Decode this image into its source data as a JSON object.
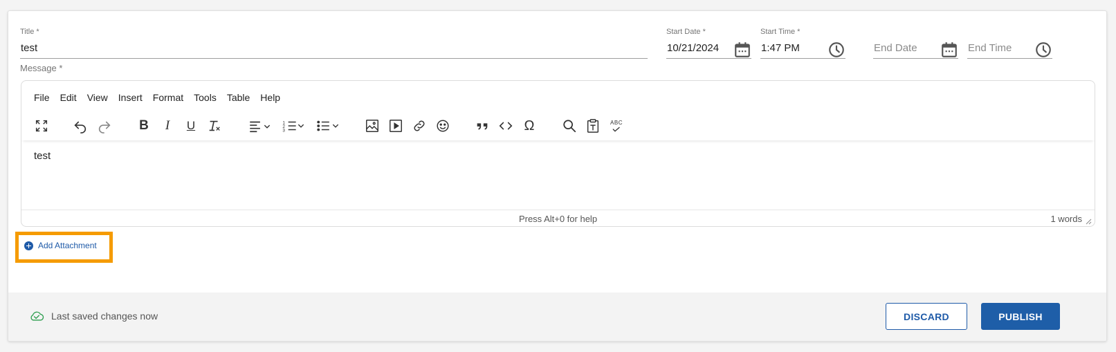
{
  "form": {
    "title": {
      "label": "Title *",
      "value": "test"
    },
    "message_label": "Message *",
    "start_date": {
      "label": "Start Date *",
      "value": "10/21/2024",
      "icon": "calendar-icon"
    },
    "start_time": {
      "label": "Start Time *",
      "value": "1:47 PM",
      "icon": "clock-icon"
    },
    "end_date": {
      "placeholder": "End Date",
      "icon": "calendar-icon"
    },
    "end_time": {
      "placeholder": "End Time",
      "icon": "clock-icon"
    }
  },
  "editor": {
    "menu": [
      "File",
      "Edit",
      "View",
      "Insert",
      "Format",
      "Tools",
      "Table",
      "Help"
    ],
    "toolbar_icons": [
      "fullscreen-icon",
      "undo-icon",
      "redo-icon",
      "bold-icon",
      "italic-icon",
      "underline-icon",
      "clear-format-icon",
      "align-icon",
      "numbered-list-icon",
      "bullet-list-icon",
      "image-icon",
      "media-icon",
      "link-icon",
      "emoticon-icon",
      "blockquote-icon",
      "code-icon",
      "special-char-icon",
      "search-icon",
      "paste-text-icon",
      "spellcheck-icon"
    ],
    "toolbar": {
      "bold": "B",
      "italic": "I",
      "underline": "U",
      "omega": "Ω",
      "spellcheck": "ABC"
    },
    "content": "test",
    "status_help": "Press Alt+0 for help",
    "word_count": "1 words"
  },
  "attachment": {
    "label": "Add Attachment",
    "highlight_color": "#f59b00"
  },
  "footer": {
    "saved_text": "Last saved changes now",
    "discard_label": "DISCARD",
    "publish_label": "PUBLISH"
  },
  "colors": {
    "accent": "#1e5aa8",
    "saved_icon": "#2e9e4f"
  }
}
